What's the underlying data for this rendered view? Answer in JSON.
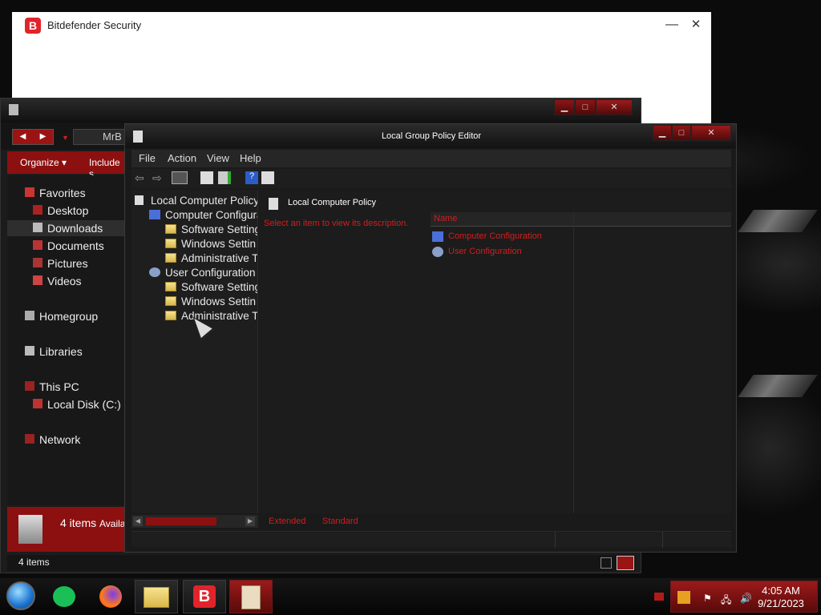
{
  "bitdefender": {
    "title": "Bitdefender Security",
    "logo_letter": "B",
    "min_glyph": "—",
    "close_glyph": "✕"
  },
  "explorer": {
    "address_text": "MrB",
    "toolbar": {
      "organize": "Organize ▾",
      "include": "Include s"
    },
    "nav_items": [
      {
        "label": "Favorites",
        "icon": "star-icon"
      },
      {
        "label": "Desktop",
        "icon": "desktop-icon"
      },
      {
        "label": "Downloads",
        "icon": "downloads-icon"
      },
      {
        "label": "Documents",
        "icon": "documents-icon"
      },
      {
        "label": "Pictures",
        "icon": "pictures-icon"
      },
      {
        "label": "Videos",
        "icon": "videos-icon"
      },
      {
        "label": "Homegroup",
        "icon": "homegroup-icon"
      },
      {
        "label": "Libraries",
        "icon": "libraries-icon"
      },
      {
        "label": "This PC",
        "icon": "pc-icon"
      },
      {
        "label": "Local Disk (C:)",
        "icon": "disk-icon"
      },
      {
        "label": "Network",
        "icon": "network-icon"
      }
    ],
    "details_count": "4 items",
    "details_avail": "Availa",
    "status_text": "4 items"
  },
  "gpedit": {
    "title": "Local Group Policy Editor",
    "menu": [
      "File",
      "Action",
      "View",
      "Help"
    ],
    "tree": [
      {
        "label": "Local Computer Policy"
      },
      {
        "label": "Computer Configura"
      },
      {
        "label": "Software Setting"
      },
      {
        "label": "Windows Settin"
      },
      {
        "label": "Administrative T"
      },
      {
        "label": "User Configuration"
      },
      {
        "label": "Software Setting"
      },
      {
        "label": "Windows Settin"
      },
      {
        "label": "Administrative T"
      }
    ],
    "header": "Local Computer Policy",
    "description": "Select an item to view its description.",
    "column_name": "Name",
    "rows": [
      "Computer Configuration",
      "User Configuration"
    ],
    "tabs": [
      "Extended",
      "Standard"
    ]
  },
  "taskbar": {
    "time": "4:05 AM",
    "date": "9/21/2023",
    "apps": [
      "start-orb",
      "chat-app",
      "firefox",
      "file-explorer",
      "bitdefender",
      "group-policy-editor"
    ]
  },
  "colors": {
    "accent_red": "#8c1010",
    "text_red": "#d41d1d"
  }
}
